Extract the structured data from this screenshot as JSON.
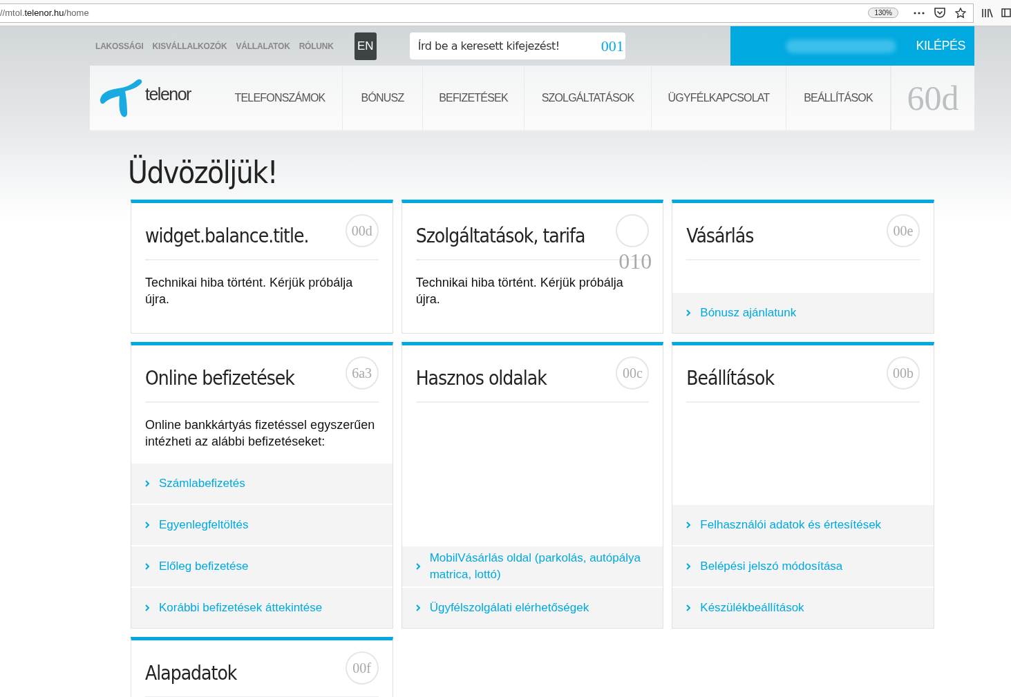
{
  "browser": {
    "url_prefix": "//mtol.",
    "url_domain": "telenor.hu",
    "url_path": "/home",
    "zoom": "130%"
  },
  "top_links": [
    {
      "label": "LAKOSSÁGI"
    },
    {
      "label": "KISVÁLLALKOZÓK"
    },
    {
      "label": "VÁLLALATOK"
    },
    {
      "label": "RÓLUNK"
    }
  ],
  "language": "EN",
  "search": {
    "placeholder": "Írd be a keresett kifejezést!",
    "icon_code": "001"
  },
  "logout": "KILÉPÉS",
  "logo": "telenor",
  "nav": [
    {
      "label": "TELEFONSZÁMOK"
    },
    {
      "label": "BÓNUSZ"
    },
    {
      "label": "BEFIZETÉSEK"
    },
    {
      "label": "SZOLGÁLTATÁSOK"
    },
    {
      "label": "ÜGYFÉLKAPCSOLAT"
    },
    {
      "label": "BEÁLLÍTÁSOK"
    }
  ],
  "nav_icon_code": "60d",
  "heading": "Üdvözöljük!",
  "cards": [
    {
      "title": "widget.balance.title.",
      "icon_code": "00d",
      "icon_code_outside": false,
      "text": "Technikai hiba történt. Kérjük próbálja újra."
    },
    {
      "title": "Szolgáltatások, tarifa",
      "icon_code": "010",
      "icon_code_outside": true,
      "text": "Technikai hiba történt. Kérjük próbálja újra."
    },
    {
      "title": "Vásárlás",
      "icon_code": "00e",
      "icon_code_outside": false,
      "links": [
        "Bónusz ajánlatunk"
      ]
    },
    {
      "title": "Online befizetések",
      "icon_code": "6a3",
      "icon_code_outside": false,
      "text": "Online bankkártyás fizetéssel egyszerűen intézheti az alábbi befizetéseket:",
      "links": [
        "Számlabefizetés",
        "Egyenlegfeltöltés",
        "Előleg befizetése",
        "Korábbi befizetések áttekintése"
      ]
    },
    {
      "title": "Hasznos oldalak",
      "icon_code": "00c",
      "icon_code_outside": false,
      "links": [
        "MobilVásárlás oldal (parkolás, autópálya matrica, lottó)",
        "Ügyfélszolgálati elérhetőségek"
      ]
    },
    {
      "title": "Beállítások",
      "icon_code": "00b",
      "icon_code_outside": false,
      "links": [
        "Felhasználói adatok és értesítések",
        "Belépési jelszó módosítása",
        "Készülékbeállítások"
      ]
    },
    {
      "title": "Alapadatok",
      "icon_code": "00f",
      "icon_code_outside": false
    }
  ]
}
